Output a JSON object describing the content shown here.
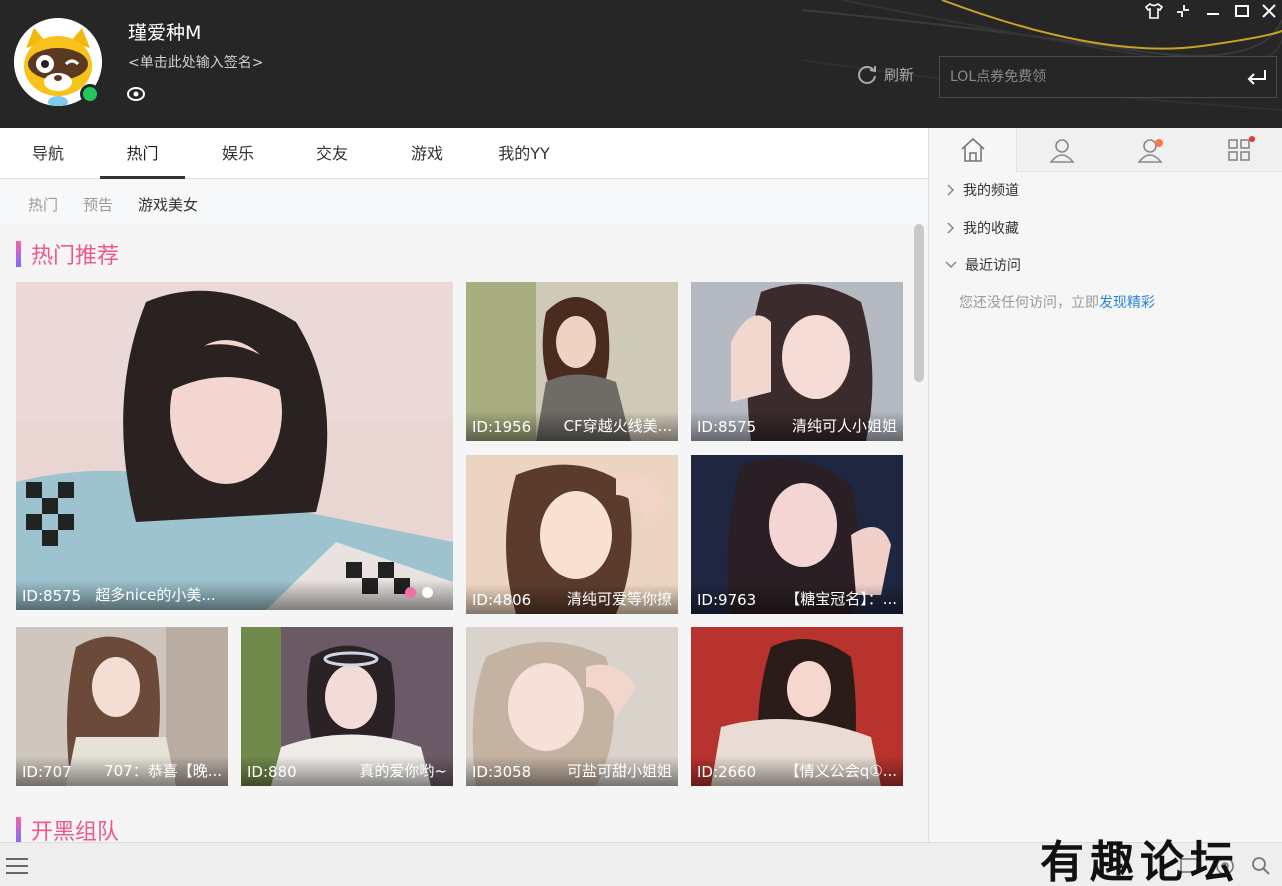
{
  "header": {
    "nickname": "瑾爱种M",
    "signature": "<单击此处输入签名>",
    "search_placeholder": "LOL点券免费领"
  },
  "window_controls": [
    "skin-icon",
    "mini-mode-icon",
    "minimize-icon",
    "maximize-icon",
    "close-icon"
  ],
  "tabs": [
    {
      "label": "导航",
      "active": false
    },
    {
      "label": "热门",
      "active": true
    },
    {
      "label": "娱乐",
      "active": false
    },
    {
      "label": "交友",
      "active": false
    },
    {
      "label": "游戏",
      "active": false
    },
    {
      "label": "我的YY",
      "active": false
    }
  ],
  "subtabs": [
    {
      "label": "热门",
      "active": false
    },
    {
      "label": "预告",
      "active": false
    },
    {
      "label": "游戏美女",
      "active": true
    }
  ],
  "refresh_label": "刷新",
  "sections": [
    {
      "title": "热门推荐"
    },
    {
      "title": "开黑组队"
    }
  ],
  "cards": [
    {
      "id": "ID:8575",
      "title": "超多nice的小美..."
    },
    {
      "id": "ID:1956",
      "title": "CF穿越火线美..."
    },
    {
      "id": "ID:8575",
      "title": "清纯可人小姐姐"
    },
    {
      "id": "ID:4806",
      "title": "清纯可爱等你撩"
    },
    {
      "id": "ID:9763",
      "title": "【糖宝冠名】：..."
    },
    {
      "id": "ID:707",
      "title": "707：恭喜【晚..."
    },
    {
      "id": "ID:880",
      "title": "真的爱你哟~"
    },
    {
      "id": "ID:3058",
      "title": "可盐可甜小姐姐"
    },
    {
      "id": "ID:2660",
      "title": "【情义公会q①..."
    }
  ],
  "carousel": {
    "count": 2,
    "active": 0
  },
  "side_tabs": [
    "home-icon",
    "contact-icon",
    "friend-notify-icon",
    "apps-icon"
  ],
  "side_tree": [
    {
      "label": "我的频道",
      "expanded": false
    },
    {
      "label": "我的收藏",
      "expanded": false
    },
    {
      "label": "最近访问",
      "expanded": true
    }
  ],
  "empty_tip": {
    "text": "您还没任何访问，立即",
    "link": "发现精彩"
  },
  "watermark": "有趣论坛",
  "colors": {
    "accent": "#f0568e",
    "header_bg": "#262626",
    "online": "#22c55e",
    "link": "#2a84d6"
  }
}
